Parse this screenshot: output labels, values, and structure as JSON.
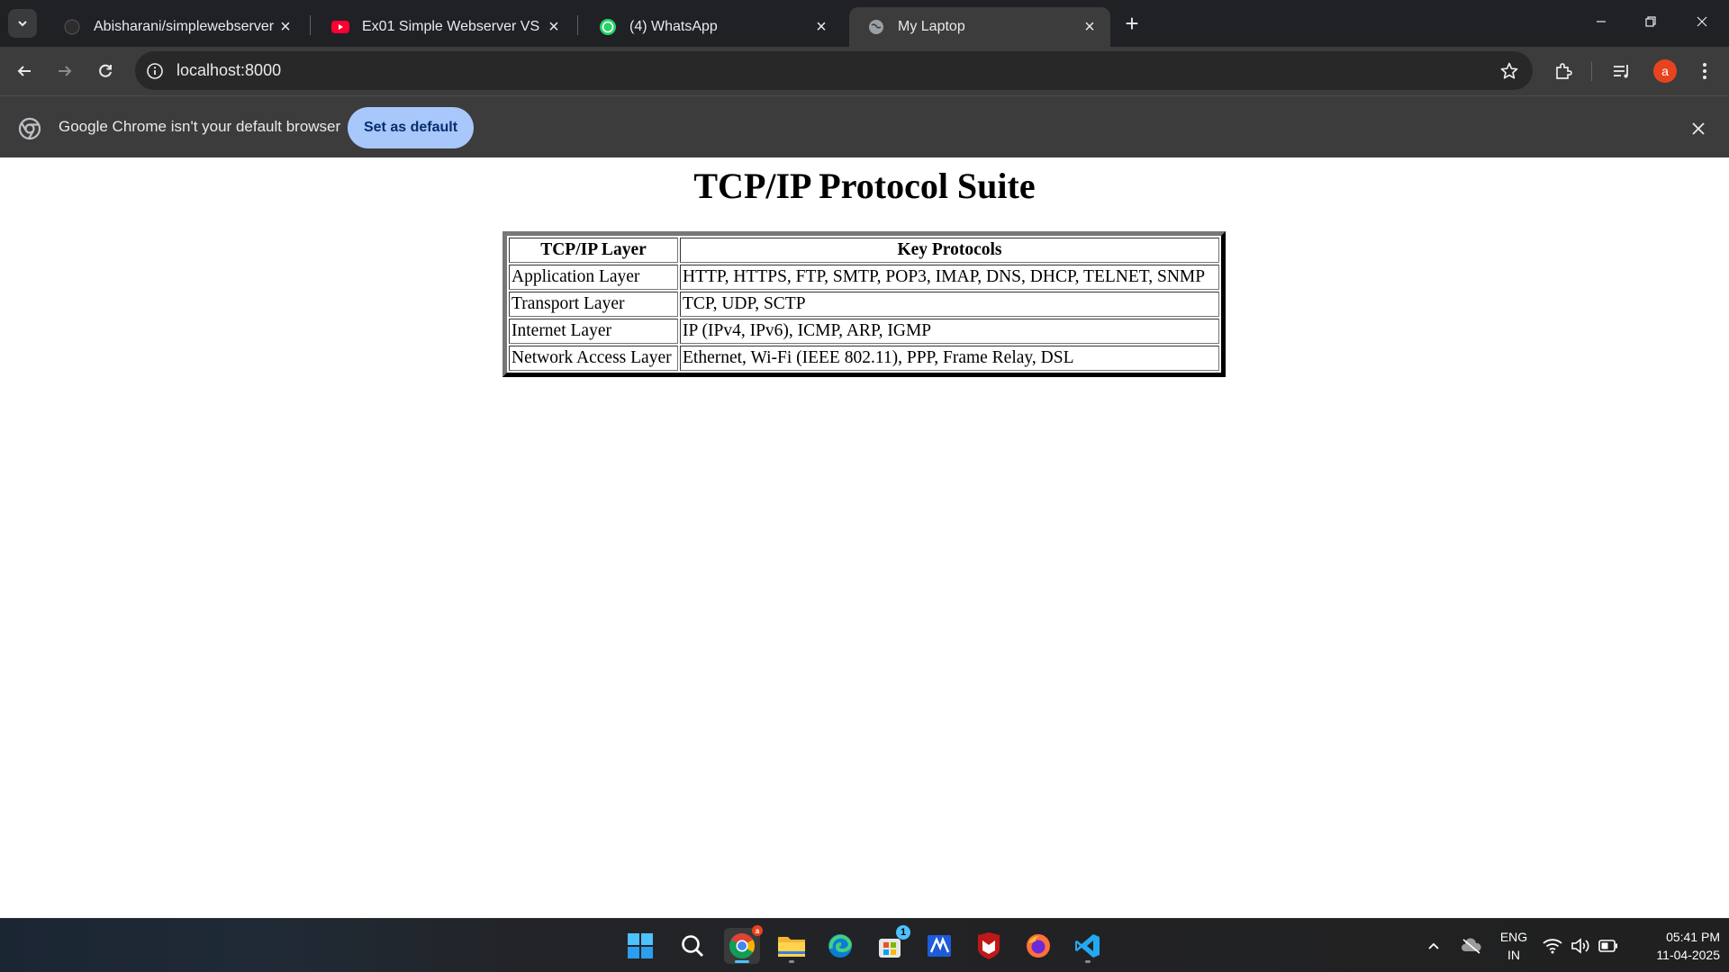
{
  "tabs": [
    {
      "title": "Abisharani/simplewebserver",
      "favicon": "github-icon",
      "active": false
    },
    {
      "title": "Ex01 Simple Webserver VS Code",
      "favicon": "youtube-icon",
      "active": false
    },
    {
      "title": "(4) WhatsApp",
      "favicon": "whatsapp-icon",
      "active": false
    },
    {
      "title": "My Laptop",
      "favicon": "globe-icon",
      "active": true
    }
  ],
  "toolbar": {
    "url": "localhost:8000",
    "profile_initial": "a"
  },
  "infobar": {
    "message": "Google Chrome isn't your default browser",
    "button": "Set as default"
  },
  "page": {
    "heading": "TCP/IP Protocol Suite",
    "table": {
      "headers": [
        "TCP/IP Layer",
        "Key Protocols"
      ],
      "rows": [
        [
          "Application Layer",
          "HTTP, HTTPS, FTP, SMTP, POP3, IMAP, DNS, DHCP, TELNET, SNMP"
        ],
        [
          "Transport Layer",
          "TCP, UDP, SCTP"
        ],
        [
          "Internet Layer",
          "IP (IPv4, IPv6), ICMP, ARP, IGMP"
        ],
        [
          "Network Access Layer",
          "Ethernet, Wi-Fi (IEEE 802.11), PPP, Frame Relay, DSL"
        ]
      ]
    }
  },
  "taskbar": {
    "apps": [
      "windows-start-icon",
      "search-icon",
      "chrome-icon",
      "file-explorer-icon",
      "edge-icon",
      "microsoft-store-icon",
      "mathway-icon",
      "mcafee-icon",
      "firefox-icon",
      "vscode-icon"
    ],
    "chrome_badge": "a",
    "store_badge": "1",
    "language_line1": "ENG",
    "language_line2": "IN",
    "time": "05:41 PM",
    "date": "11-04-2025"
  },
  "colors": {
    "titlebar": "#202124",
    "toolbar": "#3c3c3c",
    "omnibox": "#282828",
    "set_default_button": "#a8c7fa",
    "accent": "#4cc2ff"
  }
}
